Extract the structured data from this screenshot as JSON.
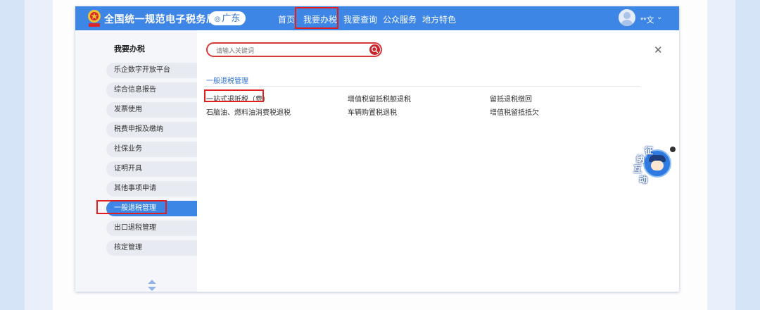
{
  "header": {
    "site_title": "全国统一规范电子税务局",
    "region": "广东",
    "nav": [
      "首页",
      "我要办税",
      "我要查询",
      "公众服务",
      "地方特色"
    ],
    "active_nav": "我要办税",
    "username": "**文"
  },
  "sidebar": {
    "heading": "我要办税",
    "items": [
      {
        "label": "乐企数字开放平台"
      },
      {
        "label": "综合信息报告"
      },
      {
        "label": "发票使用"
      },
      {
        "label": "税费申报及缴纳"
      },
      {
        "label": "社保业务"
      },
      {
        "label": "证明开具"
      },
      {
        "label": "其他事项申请"
      },
      {
        "label": "一般退税管理",
        "active": true
      },
      {
        "label": "出口退税管理"
      },
      {
        "label": "核定管理"
      }
    ]
  },
  "search": {
    "placeholder": "请输入关键词"
  },
  "section": {
    "title": "一般退税管理",
    "links": [
      [
        "一站式退抵税（费）",
        "增值税留抵税额退税",
        "留抵退税缴回"
      ],
      [
        "石脑油、燃料油消费税退税",
        "车辆购置税退税",
        "增值税留抵抵欠"
      ]
    ]
  },
  "widget": {
    "chars": [
      "征",
      "纳",
      "互",
      "动"
    ]
  },
  "colors": {
    "brand_blue": "#3d86e6",
    "highlight_red": "#e02020",
    "link_blue": "#2e6fd0"
  }
}
